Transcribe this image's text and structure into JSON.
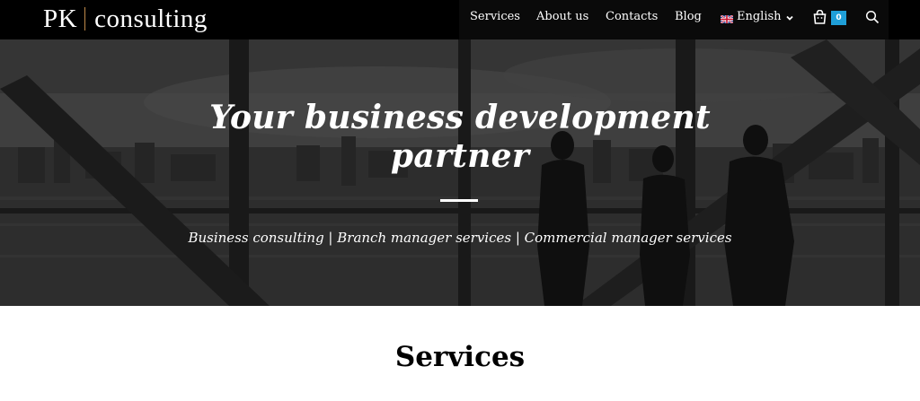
{
  "header": {
    "logo": {
      "brand": "PK",
      "name": "consulting",
      "separator_color": "#c08a4a"
    },
    "nav": {
      "items": [
        {
          "label": "Services"
        },
        {
          "label": "About us"
        },
        {
          "label": "Contacts"
        },
        {
          "label": "Blog"
        }
      ],
      "language": {
        "label": "English",
        "flag_icon": "uk-flag-icon",
        "chevron_icon": "chevron-down-icon"
      }
    },
    "cart": {
      "icon": "shopping-bag-icon",
      "count": "0",
      "badge_color": "#1f9fd8"
    },
    "search": {
      "icon": "search-icon"
    }
  },
  "hero": {
    "title": "Your business development partner",
    "subtitle": "Business consulting | Branch manager services | Commercial manager services"
  },
  "section": {
    "title": "Services"
  },
  "colors": {
    "header_bg": "#000000",
    "text_light": "#ffffff",
    "accent": "#1f9fd8"
  }
}
